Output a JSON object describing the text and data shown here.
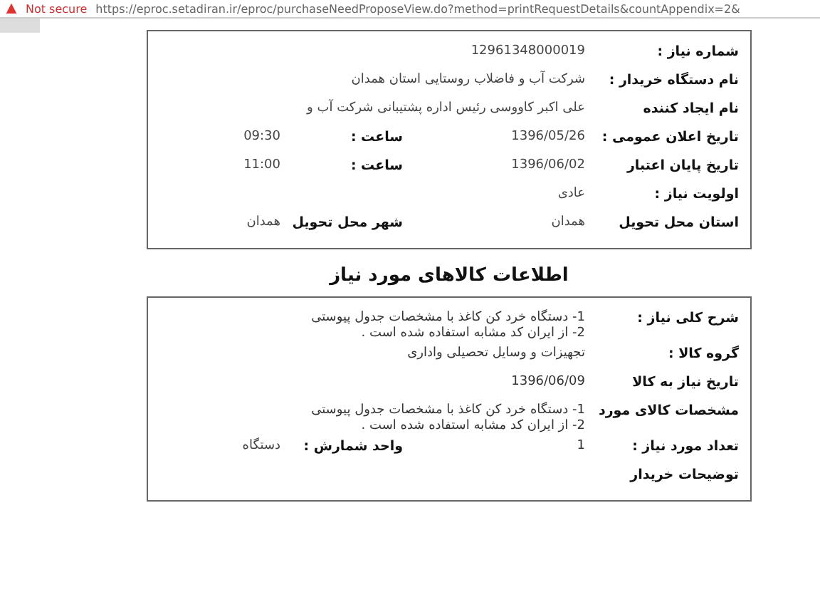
{
  "browser": {
    "security": "Not secure",
    "url": "https://eproc.setadiran.ir/eproc/purchaseNeedProposeView.do?method=printRequestDetails&countAppendix=2&"
  },
  "details": [
    {
      "label": "شماره نیاز :",
      "value": "12961348000019"
    },
    {
      "label": "نام دستگاه خریدار :",
      "value": "شرکت آب و فاضلاب روستایی استان همدان"
    },
    {
      "label": "نام ایجاد کننده",
      "value": "علی اکبر  کاووسی رئیس اداره پشتیبانی شرکت آب و"
    },
    {
      "label": "تاریخ اعلان عمومی :",
      "value": "1396/05/26",
      "label_2": "ساعت :",
      "value_2": "09:30"
    },
    {
      "label": "تاریخ پایان اعتبار",
      "value": "1396/06/02",
      "label_2": "ساعت :",
      "value_2": "11:00"
    },
    {
      "label": "اولویت نیاز :",
      "value": "عادی"
    },
    {
      "label": "استان محل تحویل",
      "value": "همدان",
      "label_2": "شهر محل تحویل",
      "value_2": "همدان"
    }
  ],
  "section_title": "اطلاعات کالاهای مورد نیاز",
  "items": [
    {
      "label": "شرح کلی نیاز :",
      "lines": [
        "1- دستگاه خرد کن کاغذ با مشخصات جدول پیوستی",
        "2- از ایران کد مشابه استفاده شده است ."
      ]
    },
    {
      "label": "گروه کالا :",
      "lines": [
        "تجهیزات و وسایل تحصیلی واداری"
      ]
    },
    {
      "label": "تاریخ نیاز به کالا",
      "lines": [
        "1396/06/09"
      ]
    },
    {
      "label": "مشخصات کالای مورد",
      "lines": [
        "1- دستگاه خرد کن کاغذ با مشخصات جدول پیوستی",
        "2- از ایران کد مشابه استفاده شده است ."
      ]
    },
    {
      "label": "تعداد مورد نیاز :",
      "lines": [
        "1"
      ],
      "label_2": "واحد شمارش :",
      "value_2": "دستگاه"
    },
    {
      "label": "توضیحات خریدار"
    }
  ]
}
